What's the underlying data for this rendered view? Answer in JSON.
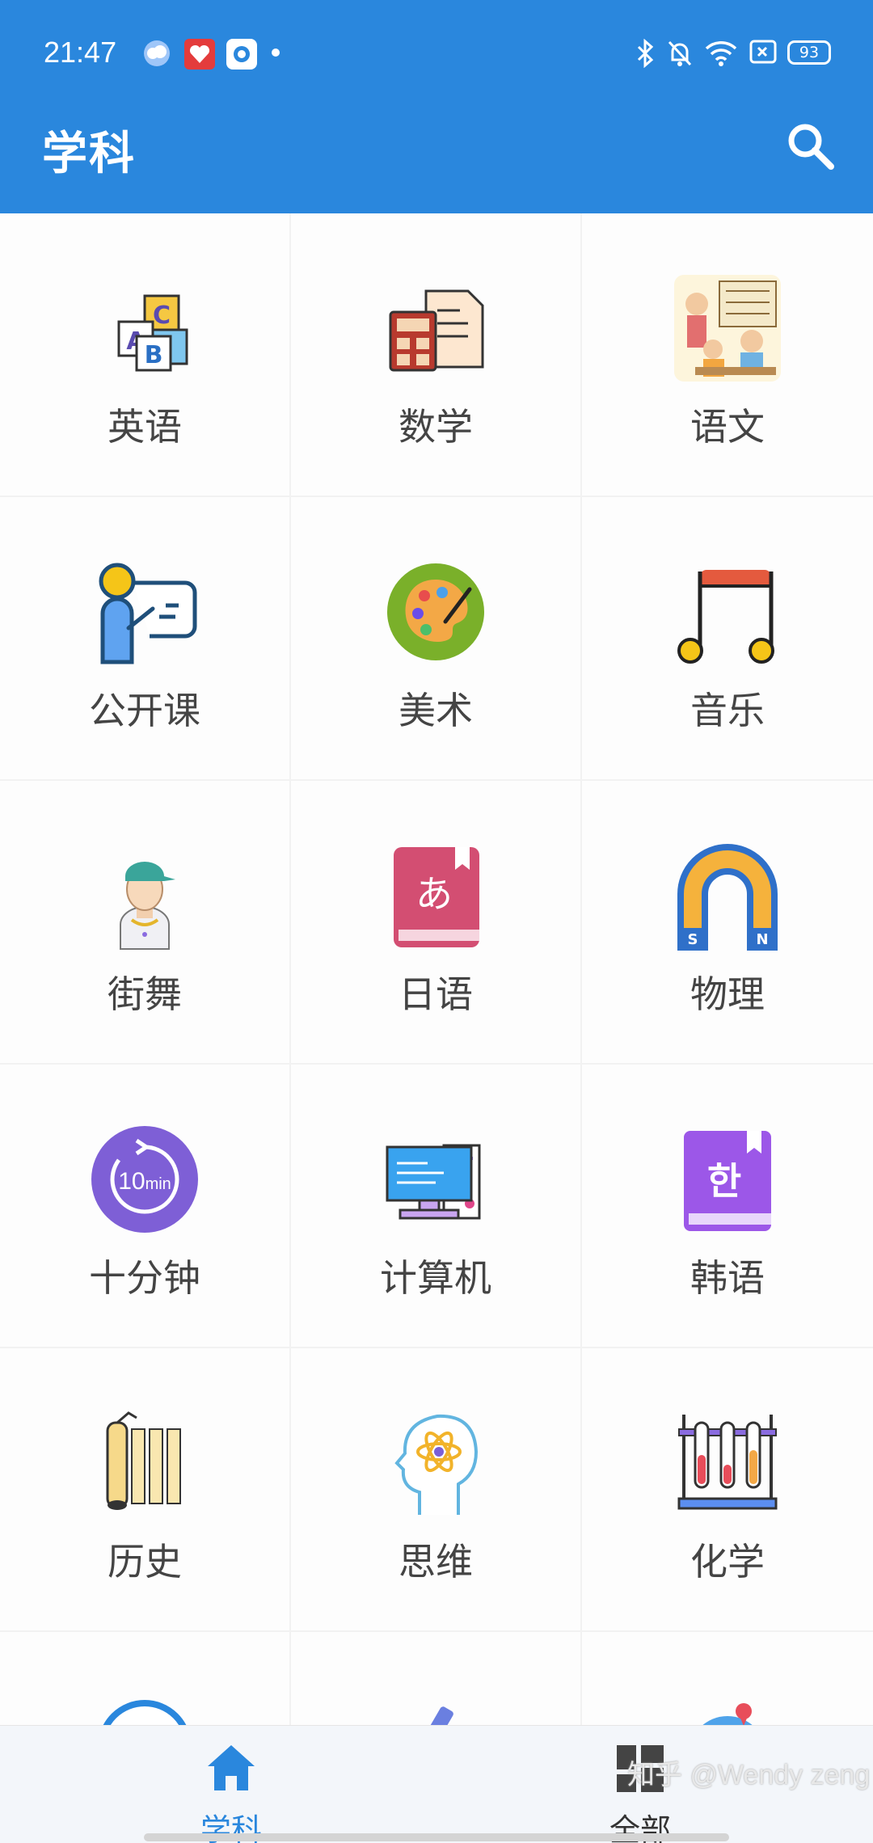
{
  "status_bar": {
    "time": "21:47",
    "battery": "93"
  },
  "header": {
    "title": "学科"
  },
  "subjects": [
    {
      "label": "英语",
      "icon": "abc-blocks-icon"
    },
    {
      "label": "数学",
      "icon": "calculator-icon"
    },
    {
      "label": "语文",
      "icon": "classroom-icon"
    },
    {
      "label": "公开课",
      "icon": "teacher-board-icon"
    },
    {
      "label": "美术",
      "icon": "palette-icon"
    },
    {
      "label": "音乐",
      "icon": "music-note-icon"
    },
    {
      "label": "街舞",
      "icon": "dancer-icon"
    },
    {
      "label": "日语",
      "icon": "japanese-book-icon"
    },
    {
      "label": "物理",
      "icon": "magnet-icon"
    },
    {
      "label": "十分钟",
      "icon": "timer-10min-icon"
    },
    {
      "label": "计算机",
      "icon": "computer-icon"
    },
    {
      "label": "韩语",
      "icon": "korean-book-icon"
    },
    {
      "label": "历史",
      "icon": "scroll-icon"
    },
    {
      "label": "思维",
      "icon": "brain-atom-icon"
    },
    {
      "label": "化学",
      "icon": "test-tubes-icon"
    },
    {
      "label": "",
      "icon": "ai-icon"
    },
    {
      "label": "",
      "icon": "microscope-icon"
    },
    {
      "label": "",
      "icon": "globe-icon"
    }
  ],
  "bottom_nav": {
    "home_label": "学科",
    "all_label": "全部"
  },
  "watermark": "知乎 @Wendy zeng",
  "colors": {
    "primary": "#2a87dd",
    "text": "#444444"
  }
}
